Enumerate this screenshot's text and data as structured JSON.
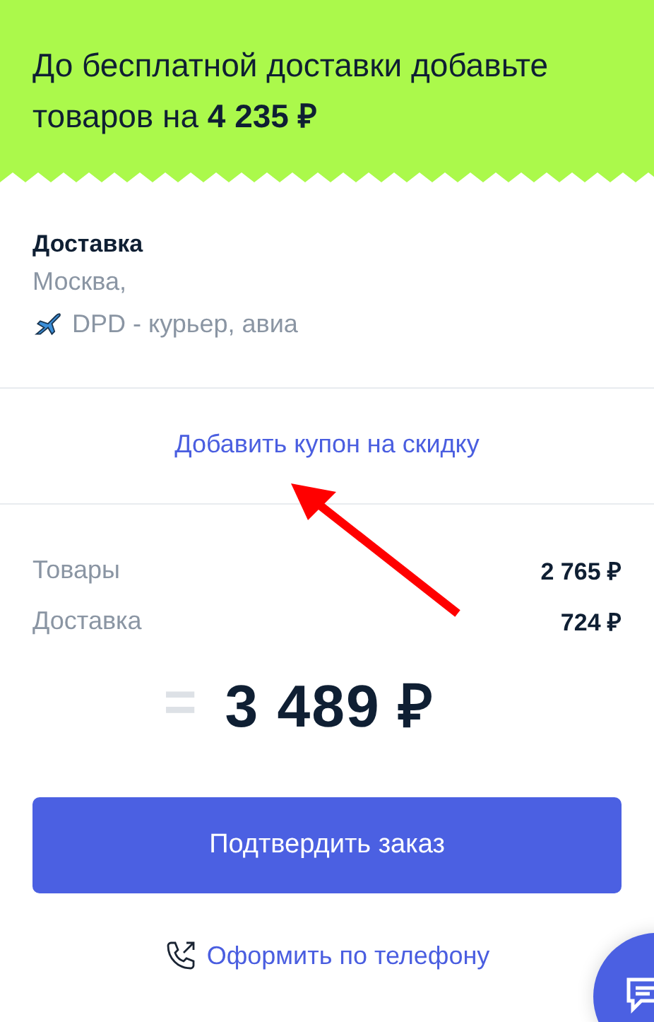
{
  "banner": {
    "text": "До бесплатной доставки добавьте товаров на **4 235 ₽**"
  },
  "delivery": {
    "title": "Доставка",
    "city": "Москва,",
    "method": "DPD - курьер, авиа"
  },
  "coupon": {
    "label": "Добавить купон на скидку"
  },
  "summary": [
    {
      "label": "Товары",
      "value": "2 765 ₽"
    },
    {
      "label": "Доставка",
      "value": "724 ₽"
    }
  ],
  "total": {
    "sign": "=",
    "value": "3 489 ₽"
  },
  "confirm_button": {
    "label": "Подтвердить заказ"
  },
  "phone_order": {
    "label": "Оформить по телефону"
  }
}
